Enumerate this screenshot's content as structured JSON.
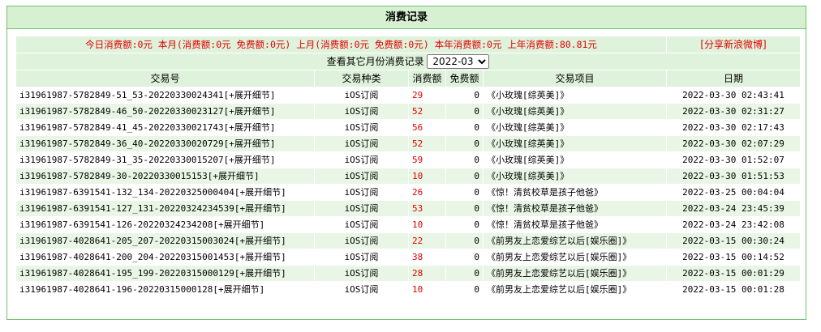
{
  "panel": {
    "title": "消费记录"
  },
  "summary": {
    "text": "今日消费额:0元 本月(消费额:0元 免费额:0元) 上月(消费额:0元 免费额:0元) 本年消费额:0元 上年消费额:80.81元",
    "share_link": "[分享新浪微博]"
  },
  "filter": {
    "label": "查看其它月份消费记录",
    "selected_month": "2022-03"
  },
  "table": {
    "headers": [
      "交易号",
      "交易种类",
      "消费额",
      "免费额",
      "交易项目",
      "日期"
    ],
    "rows": [
      {
        "id": "i31961987-5782849-51_53-20220330024341[+展开细节]",
        "type": "iOS订阅",
        "amount": "29",
        "free": "0",
        "item": "《小玫瑰[综英美]》",
        "date": "2022-03-30 02:43:41"
      },
      {
        "id": "i31961987-5782849-46_50-20220330023127[+展开细节]",
        "type": "iOS订阅",
        "amount": "52",
        "free": "0",
        "item": "《小玫瑰[综英美]》",
        "date": "2022-03-30 02:31:27"
      },
      {
        "id": "i31961987-5782849-41_45-20220330021743[+展开细节]",
        "type": "iOS订阅",
        "amount": "56",
        "free": "0",
        "item": "《小玫瑰[综英美]》",
        "date": "2022-03-30 02:17:43"
      },
      {
        "id": "i31961987-5782849-36_40-20220330020729[+展开细节]",
        "type": "iOS订阅",
        "amount": "52",
        "free": "0",
        "item": "《小玫瑰[综英美]》",
        "date": "2022-03-30 02:07:29"
      },
      {
        "id": "i31961987-5782849-31_35-20220330015207[+展开细节]",
        "type": "iOS订阅",
        "amount": "59",
        "free": "0",
        "item": "《小玫瑰[综英美]》",
        "date": "2022-03-30 01:52:07"
      },
      {
        "id": "i31961987-5782849-30-20220330015153[+展开细节]",
        "type": "iOS订阅",
        "amount": "10",
        "free": "0",
        "item": "《小玫瑰[综英美]》",
        "date": "2022-03-30 01:51:53"
      },
      {
        "id": "i31961987-6391541-132_134-20220325000404[+展开细节]",
        "type": "iOS订阅",
        "amount": "26",
        "free": "0",
        "item": "《惊！清贫校草是孩子他爸》",
        "date": "2022-03-25 00:04:04"
      },
      {
        "id": "i31961987-6391541-127_131-20220324234539[+展开细节]",
        "type": "iOS订阅",
        "amount": "53",
        "free": "0",
        "item": "《惊！清贫校草是孩子他爸》",
        "date": "2022-03-24 23:45:39"
      },
      {
        "id": "i31961987-6391541-126-20220324234208[+展开细节]",
        "type": "iOS订阅",
        "amount": "10",
        "free": "0",
        "item": "《惊！清贫校草是孩子他爸》",
        "date": "2022-03-24 23:42:08"
      },
      {
        "id": "i31961987-4028641-205_207-20220315003024[+展开细节]",
        "type": "iOS订阅",
        "amount": "22",
        "free": "0",
        "item": "《前男友上恋爱综艺以后[娱乐圈]》",
        "date": "2022-03-15 00:30:24"
      },
      {
        "id": "i31961987-4028641-200_204-20220315001453[+展开细节]",
        "type": "iOS订阅",
        "amount": "38",
        "free": "0",
        "item": "《前男友上恋爱综艺以后[娱乐圈]》",
        "date": "2022-03-15 00:14:52"
      },
      {
        "id": "i31961987-4028641-195_199-20220315000129[+展开细节]",
        "type": "iOS订阅",
        "amount": "28",
        "free": "0",
        "item": "《前男友上恋爱综艺以后[娱乐圈]》",
        "date": "2022-03-15 00:01:29"
      },
      {
        "id": "i31961987-4028641-196-20220315000128[+展开细节]",
        "type": "iOS订阅",
        "amount": "10",
        "free": "0",
        "item": "《前男友上恋爱综艺以后[娱乐圈]》",
        "date": "2022-03-15 00:01:28"
      }
    ]
  },
  "colors": {
    "border": "#6fbf6f",
    "header_bg": "#d7f0d2",
    "row_alt_bg": "#e9f6e6",
    "highlight_red": "#e00000"
  }
}
